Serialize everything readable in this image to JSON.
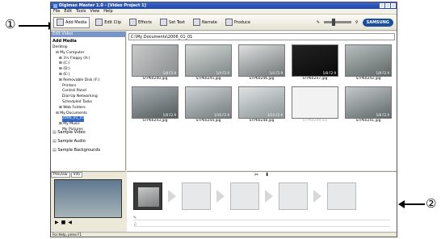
{
  "callouts": {
    "one": "①",
    "two": "②"
  },
  "window": {
    "title": "Digimax Master 1.0 - [Video Project 1]"
  },
  "menu": [
    "File",
    "Edit",
    "Tools",
    "View",
    "Help"
  ],
  "toolbar": {
    "add_media": "Add Media",
    "edit_clip": "Edit Clip",
    "effects": "Effects",
    "set_text": "Set Text",
    "narrate": "Narrate",
    "produce": "Produce",
    "brand": "SAMSUNG"
  },
  "left": {
    "pane_title": "Edit Video",
    "section_title": "Add Media",
    "tree": [
      "Desktop",
      "My Computer",
      "3½ Floppy (A:)",
      "(C:)",
      "(D:)",
      "(E:)",
      "Removable Disk (F:)",
      "Printers",
      "Control Panel",
      "Dial-Up Networking",
      "Scheduled Tasks",
      "Web Folders",
      "My Documents",
      "2006_01_01",
      "My Music",
      "My Pictures"
    ],
    "samples": [
      "Sample Video",
      "Sample Audio",
      "Sample Backgrounds"
    ]
  },
  "path": "C:\\My Documents\\2006_01_01",
  "thumbs": [
    {
      "name": "STP60240.jpg",
      "meta": "1/8 F2.9"
    },
    {
      "name": "STP60245.jpg",
      "meta": "1/4 F2.9"
    },
    {
      "name": "STP60246.jpg",
      "meta": "1/4 F2.9"
    },
    {
      "name": "STP60247.jpg",
      "meta": "1/8 F2.9"
    },
    {
      "name": "STP60242.jpg",
      "meta": "1/8 F2.9"
    },
    {
      "name": "STP60243.jpg",
      "meta": "1/8 F2.9"
    },
    {
      "name": "STP60244.jpg",
      "meta": "1/10 F2.9"
    },
    {
      "name": "STP60248.jpg",
      "meta": "1/13 F2.9"
    },
    {
      "name": "STP60249.avi",
      "meta": ""
    },
    {
      "name": "STP60241.jpg",
      "meta": "1/8 F2.9"
    }
  ],
  "preview": {
    "tab1": "Preview",
    "tab2": "Info"
  },
  "status": "For Help, press F1"
}
